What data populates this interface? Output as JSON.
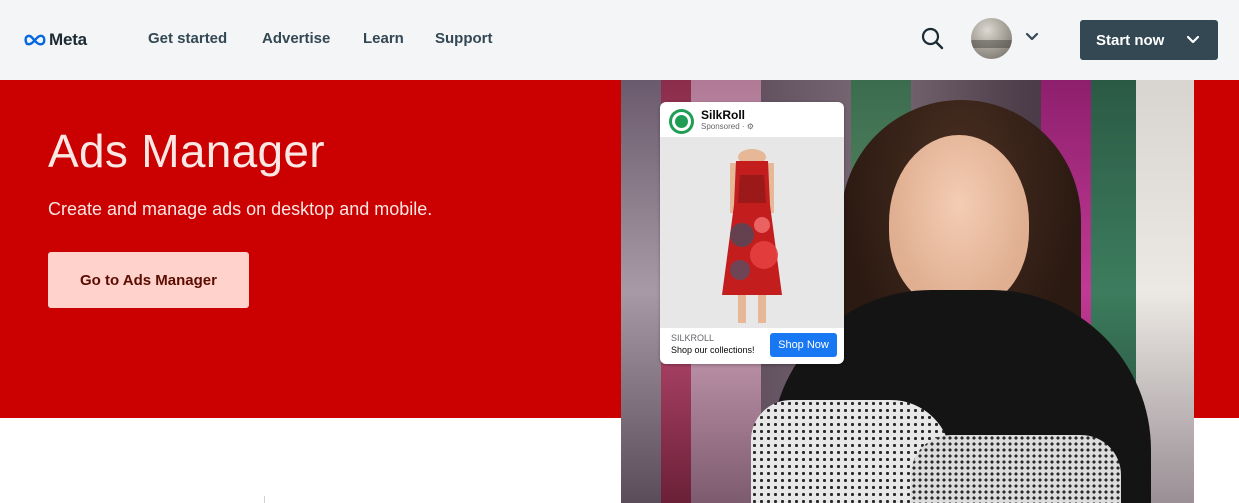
{
  "nav": {
    "logo_text": "Meta",
    "links": [
      "Get started",
      "Advertise",
      "Learn",
      "Support"
    ],
    "search_icon": "search-icon",
    "avatar_icon": "user-avatar",
    "chevron_icon": "chevron-down-icon",
    "start_button": "Start now"
  },
  "hero": {
    "title": "Ads Manager",
    "subtitle": "Create and manage ads on desktop and mobile.",
    "cta": "Go to Ads Manager",
    "background": "#cb0000"
  },
  "ad_preview": {
    "brand": "SilkRoll",
    "sponsored": "Sponsored · ⚙",
    "footer_label": "SILKROLL",
    "footer_desc": "Shop our collections!",
    "shop_button": "Shop Now"
  },
  "colors": {
    "nav_bg": "#f3f5f6",
    "nav_text": "#344854",
    "hero_red": "#cb0000",
    "cta_bg": "#ffd2cc",
    "shop_blue": "#1877f2"
  }
}
